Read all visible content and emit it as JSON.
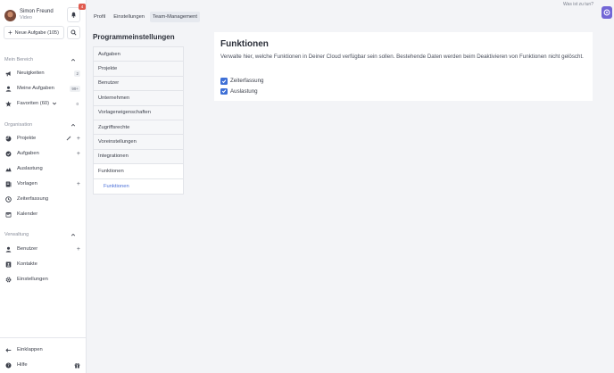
{
  "user": {
    "name": "Simon Freund",
    "subtitle": "Video"
  },
  "notifications": {
    "count": "4"
  },
  "sidebar": {
    "new_task_label": "Neue Aufgabe (105)",
    "sections": {
      "main": "Mein Bereich",
      "organisation": "Organisation",
      "administration": "Verwaltung"
    },
    "main_items": [
      {
        "label": "Neuigkeiten",
        "icon": "megaphone-icon",
        "badge": "2"
      },
      {
        "label": "Meine Aufgaben",
        "icon": "user-icon",
        "badge": "99+"
      },
      {
        "label": "Favoriten (60)",
        "icon": "star-icon",
        "badge": "0"
      }
    ],
    "org_items": [
      {
        "label": "Projekte",
        "icon": "projects-icon"
      },
      {
        "label": "Aufgaben",
        "icon": "tasks-icon"
      },
      {
        "label": "Auslastung",
        "icon": "workload-icon"
      },
      {
        "label": "Vorlagen",
        "icon": "templates-icon"
      },
      {
        "label": "Zeiterfassung",
        "icon": "time-tracking-icon"
      },
      {
        "label": "Kalender",
        "icon": "calendar-icon"
      }
    ],
    "admin_items": [
      {
        "label": "Benutzer",
        "icon": "users-icon"
      },
      {
        "label": "Kontakte",
        "icon": "contacts-icon"
      },
      {
        "label": "Einstellungen",
        "icon": "gear-icon"
      }
    ],
    "collapse_label": "Einklappen",
    "help_label": "Hilfe"
  },
  "tabs": [
    {
      "label": "Profil",
      "active": false
    },
    {
      "label": "Einstellungen",
      "active": false
    },
    {
      "label": "Team-Management",
      "active": true
    }
  ],
  "help_link": "Was ist zu tun?",
  "settings": {
    "title": "Programmeinstellungen",
    "items": [
      "Aufgaben",
      "Projekte",
      "Benutzer",
      "Unternehmen",
      "Vorlageneigenschaften",
      "Zugriffsrechte",
      "Voreinstellungen",
      "Integrationen",
      "Funktionen"
    ],
    "sub_item": "Funktionen"
  },
  "functions_card": {
    "title": "Funktionen",
    "description": "Verwalte hier, welche Funktionen in Deiner Cloud verfügbar sein sollen. Bestehende Daten werden beim Deaktivieren von Funktionen nicht gelöscht.",
    "options": [
      {
        "label": "Zeiterfassung",
        "checked": true
      },
      {
        "label": "Auslastung",
        "checked": true
      }
    ]
  },
  "colors": {
    "accent": "#3e6fd6",
    "badge": "#e05b4f",
    "app_icon": "#7266d6"
  }
}
